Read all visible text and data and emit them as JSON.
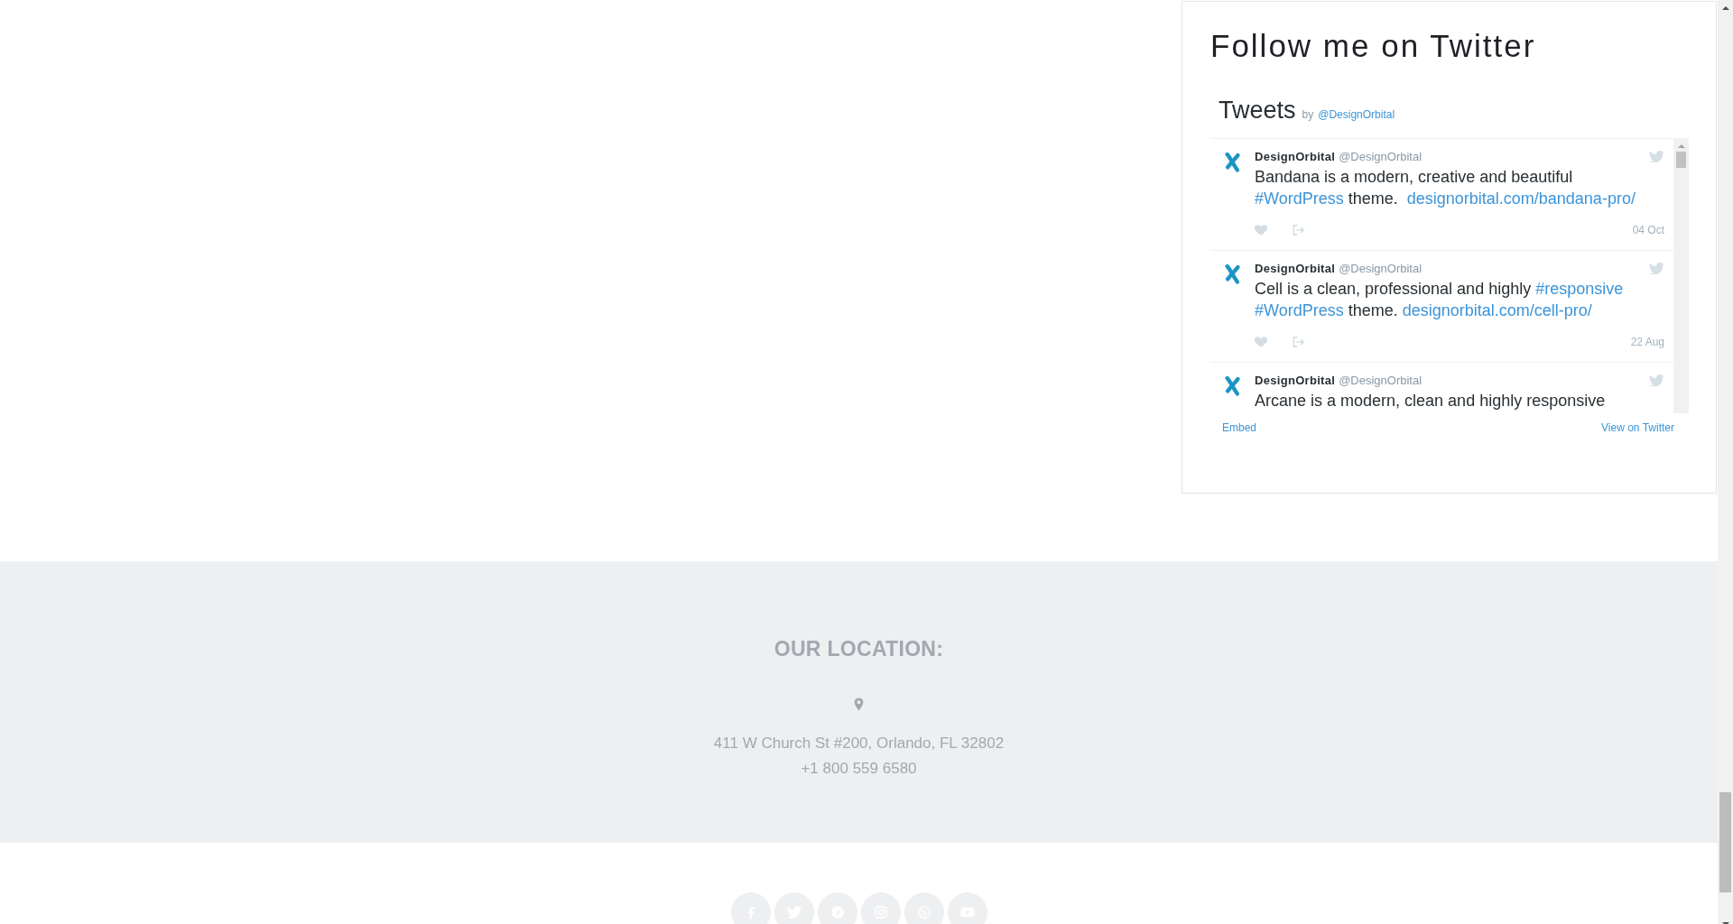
{
  "widget": {
    "title": "Follow me on Twitter",
    "timeline": {
      "heading": "Tweets",
      "by": "by",
      "account": "@DesignOrbital",
      "tweets": [
        {
          "name": "DesignOrbital",
          "handle": "@DesignOrbital",
          "text": [
            {
              "kind": "plain",
              "text": "Bandana is a modern, creative and beautiful "
            },
            {
              "kind": "hashtag",
              "text": "#WordPress"
            },
            {
              "kind": "plain",
              "text": " theme.  "
            },
            {
              "kind": "url",
              "text": "designorbital.com/bandana-pro/"
            }
          ],
          "date": "04 Oct"
        },
        {
          "name": "DesignOrbital",
          "handle": "@DesignOrbital",
          "text": [
            {
              "kind": "plain",
              "text": "Cell is a clean, professional and highly "
            },
            {
              "kind": "hashtag",
              "text": "#responsive"
            },
            {
              "kind": "hashtag",
              "text": "#WordPress"
            },
            {
              "kind": "plain",
              "text": " theme. "
            },
            {
              "kind": "url",
              "text": "designorbital.com/cell-pro/"
            }
          ],
          "date": "22 Aug"
        },
        {
          "name": "DesignOrbital",
          "handle": "@DesignOrbital",
          "text": [
            {
              "kind": "plain",
              "text": "Arcane is a modern, clean and highly responsive"
            }
          ]
        }
      ],
      "footer_links": [
        "Embed",
        "View on Twitter"
      ]
    }
  },
  "location": {
    "heading": "OUR LOCATION:",
    "address": "411 W Church St #200, Orlando, FL 32802",
    "phone": "+1 800 559 6580"
  },
  "social_links": [
    {
      "kind": "facebook"
    },
    {
      "kind": "twitter"
    },
    {
      "kind": "pinterest"
    },
    {
      "kind": "instagram"
    },
    {
      "kind": "dribbble"
    },
    {
      "kind": "youtube"
    }
  ]
}
